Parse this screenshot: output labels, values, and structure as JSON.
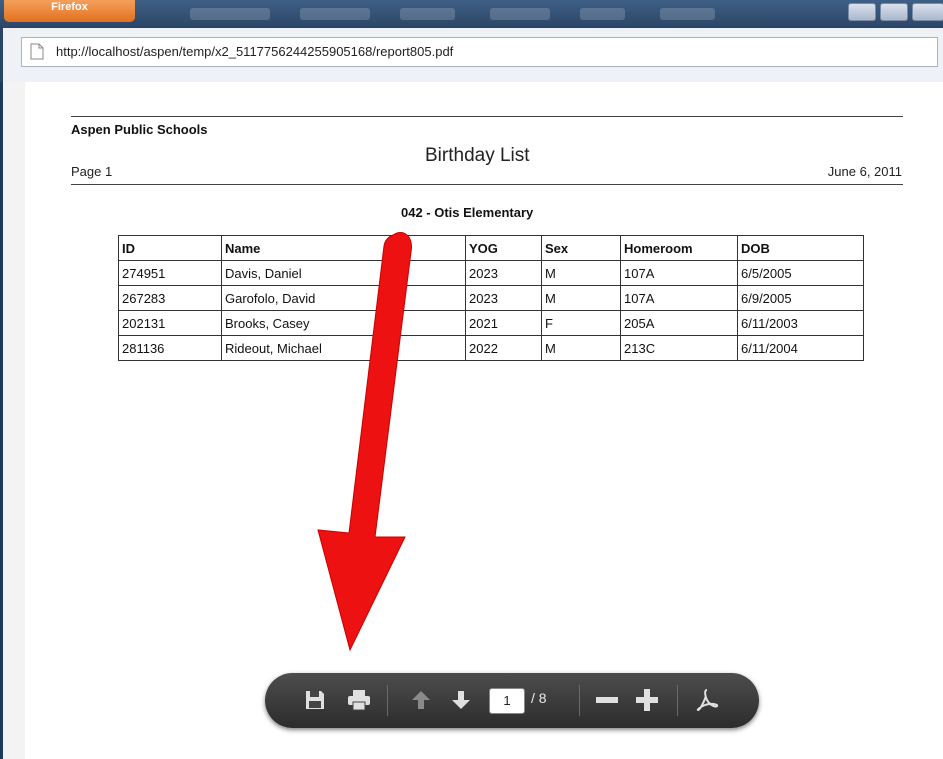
{
  "browser": {
    "app_button_label": "Firefox",
    "url": "http://localhost/aspen/temp/x2_5117756244255905168/report805.pdf"
  },
  "report": {
    "organization": "Aspen Public Schools",
    "title": "Birthday List",
    "page_label": "Page 1",
    "date": "June 6, 2011",
    "school": "042 - Otis Elementary",
    "columns": [
      "ID",
      "Name",
      "YOG",
      "Sex",
      "Homeroom",
      "DOB"
    ],
    "rows": [
      [
        "274951",
        "Davis, Daniel",
        "2023",
        "M",
        "107A",
        "6/5/2005"
      ],
      [
        "267283",
        "Garofolo, David",
        "2023",
        "M",
        "107A",
        "6/9/2005"
      ],
      [
        "202131",
        "Brooks, Casey",
        "2021",
        "F",
        "205A",
        "6/11/2003"
      ],
      [
        "281136",
        "Rideout, Michael",
        "2022",
        "M",
        "213C",
        "6/11/2004"
      ]
    ]
  },
  "pdf_toolbar": {
    "current_page": "1",
    "total_pages": "/ 8",
    "icons": [
      "save-icon",
      "print-icon",
      "page-up-icon",
      "page-down-icon",
      "zoom-out-icon",
      "zoom-in-icon",
      "acrobat-icon"
    ]
  },
  "colors": {
    "annotation_arrow": "#ee1111",
    "toolbar_bg": "#3a3a3a"
  }
}
